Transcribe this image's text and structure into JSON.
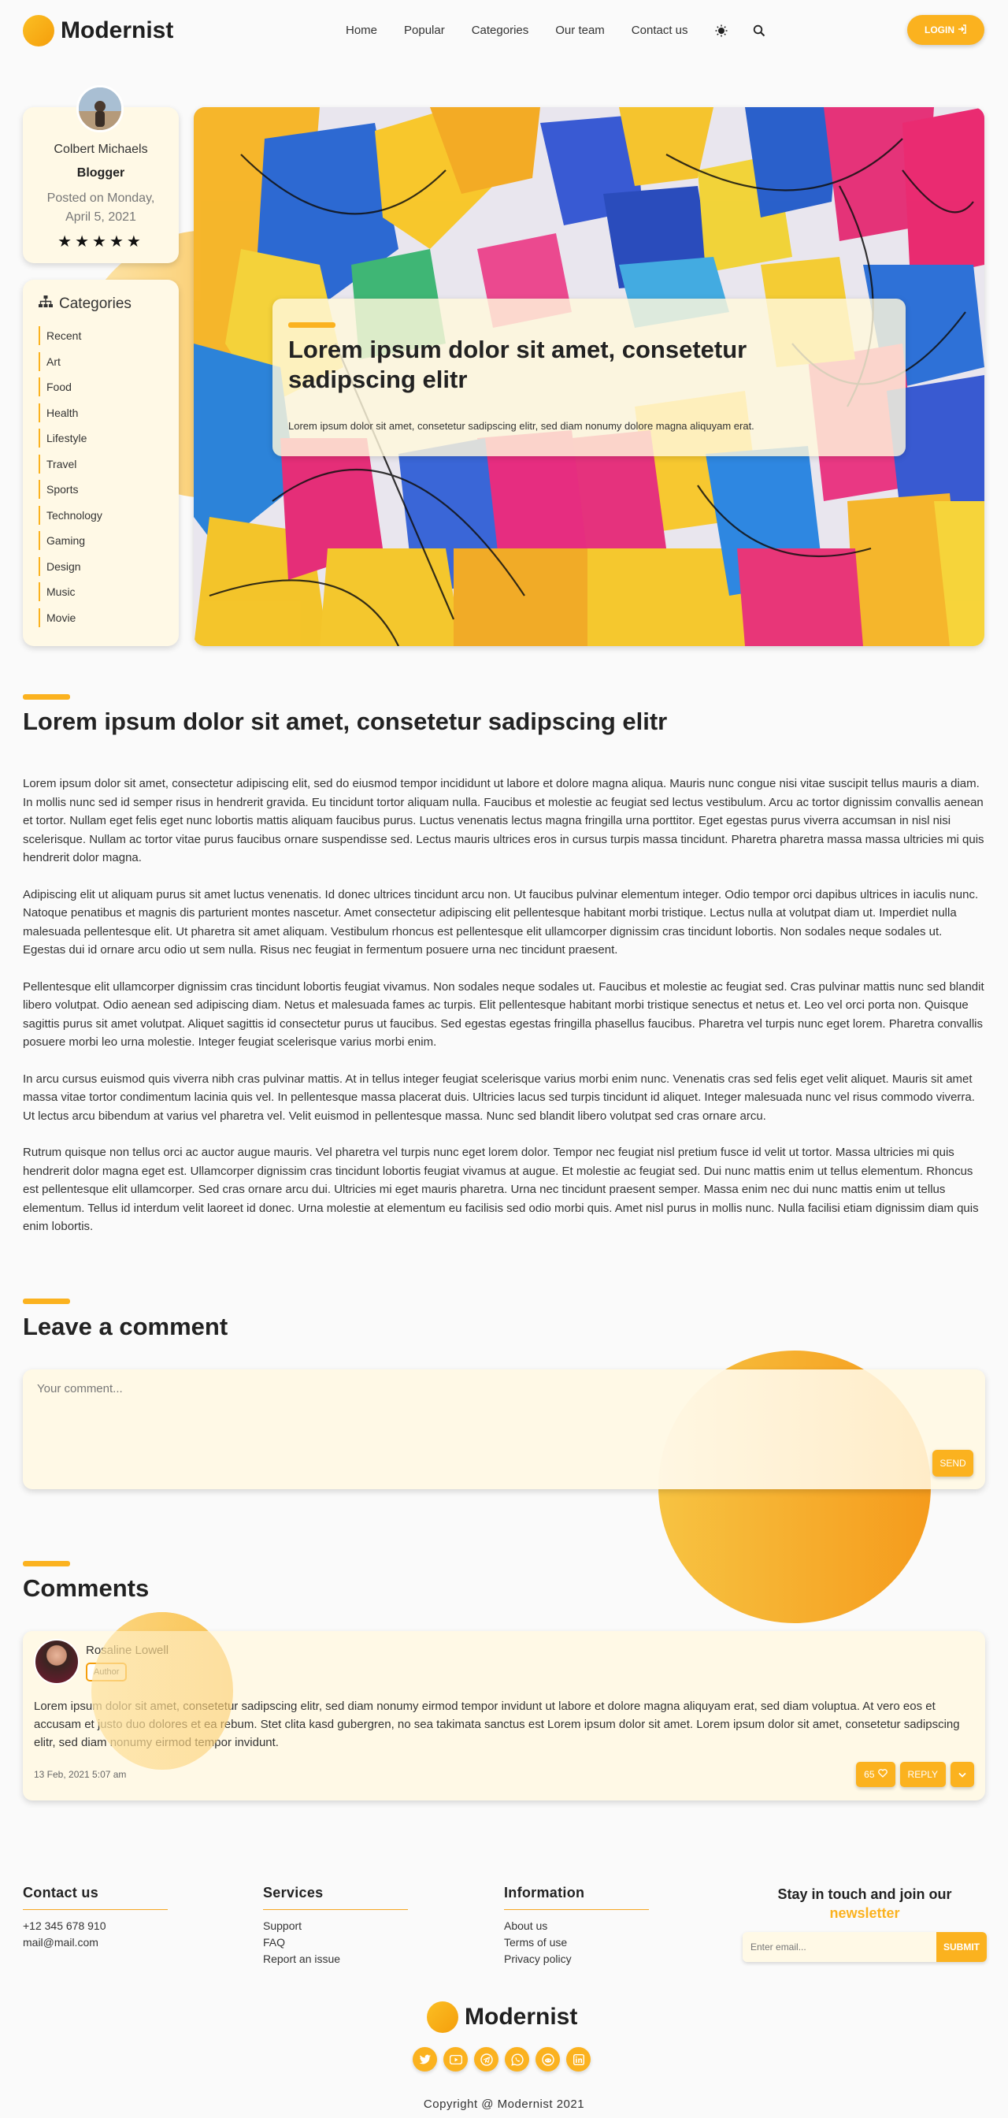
{
  "brand": {
    "name": "Modernist",
    "accent": "#fbb21f"
  },
  "nav": {
    "items": [
      "Home",
      "Popular",
      "Categories",
      "Our team",
      "Contact us"
    ],
    "login": "LOGIN"
  },
  "author": {
    "name": "Colbert Michaels",
    "role": "Blogger",
    "posted": "Posted on Monday, April 5, 2021",
    "stars": "★★★★★"
  },
  "categories": {
    "title": "Categories",
    "items": [
      "Recent",
      "Art",
      "Food",
      "Health",
      "Lifestyle",
      "Travel",
      "Sports",
      "Technology",
      "Gaming",
      "Design",
      "Music",
      "Movie"
    ]
  },
  "hero": {
    "title": "Lorem ipsum dolor sit amet, consetetur sadipscing elitr",
    "text": "Lorem ipsum dolor sit amet, consetetur sadipscing elitr, sed diam nonumy dolore magna aliquyam erat."
  },
  "article": {
    "title": "Lorem ipsum dolor sit amet, consetetur sadipscing elitr",
    "paragraphs": [
      "Lorem ipsum dolor sit amet, consectetur adipiscing elit, sed do eiusmod tempor incididunt ut labore et dolore magna aliqua. Mauris nunc congue nisi vitae suscipit tellus mauris a diam. In mollis nunc sed id semper risus in hendrerit gravida. Eu tincidunt tortor aliquam nulla. Faucibus et molestie ac feugiat sed lectus vestibulum. Arcu ac tortor dignissim convallis aenean et tortor. Nullam eget felis eget nunc lobortis mattis aliquam faucibus purus. Luctus venenatis lectus magna fringilla urna porttitor. Eget egestas purus viverra accumsan in nisl nisi scelerisque. Nullam ac tortor vitae purus faucibus ornare suspendisse sed. Lectus mauris ultrices eros in cursus turpis massa tincidunt. Pharetra pharetra massa massa ultricies mi quis hendrerit dolor magna.",
      "Adipiscing elit ut aliquam purus sit amet luctus venenatis. Id donec ultrices tincidunt arcu non. Ut faucibus pulvinar elementum integer. Odio tempor orci dapibus ultrices in iaculis nunc. Natoque penatibus et magnis dis parturient montes nascetur. Amet consectetur adipiscing elit pellentesque habitant morbi tristique. Lectus nulla at volutpat diam ut. Imperdiet nulla malesuada pellentesque elit. Ut pharetra sit amet aliquam. Vestibulum rhoncus est pellentesque elit ullamcorper dignissim cras tincidunt lobortis. Non sodales neque sodales ut. Egestas dui id ornare arcu odio ut sem nulla. Risus nec feugiat in fermentum posuere urna nec tincidunt praesent.",
      "Pellentesque elit ullamcorper dignissim cras tincidunt lobortis feugiat vivamus. Non sodales neque sodales ut. Faucibus et molestie ac feugiat sed. Cras pulvinar mattis nunc sed blandit libero volutpat. Odio aenean sed adipiscing diam. Netus et malesuada fames ac turpis. Elit pellentesque habitant morbi tristique senectus et netus et. Leo vel orci porta non. Quisque sagittis purus sit amet volutpat. Aliquet sagittis id consectetur purus ut faucibus. Sed egestas egestas fringilla phasellus faucibus. Pharetra vel turpis nunc eget lorem. Pharetra convallis posuere morbi leo urna molestie. Integer feugiat scelerisque varius morbi enim.",
      "In arcu cursus euismod quis viverra nibh cras pulvinar mattis. At in tellus integer feugiat scelerisque varius morbi enim nunc. Venenatis cras sed felis eget velit aliquet. Mauris sit amet massa vitae tortor condimentum lacinia quis vel. In pellentesque massa placerat duis. Ultricies lacus sed turpis tincidunt id aliquet. Integer malesuada nunc vel risus commodo viverra. Ut lectus arcu bibendum at varius vel pharetra vel. Velit euismod in pellentesque massa. Nunc sed blandit libero volutpat sed cras ornare arcu.",
      "Rutrum quisque non tellus orci ac auctor augue mauris. Vel pharetra vel turpis nunc eget lorem dolor. Tempor nec feugiat nisl pretium fusce id velit ut tortor. Massa ultricies mi quis hendrerit dolor magna eget est. Ullamcorper dignissim cras tincidunt lobortis feugiat vivamus at augue. Et molestie ac feugiat sed. Dui nunc mattis enim ut tellus elementum. Rhoncus est pellentesque elit ullamcorper. Sed cras ornare arcu dui. Ultricies mi eget mauris pharetra. Urna nec tincidunt praesent semper. Massa enim nec dui nunc mattis enim ut tellus elementum. Tellus id interdum velit laoreet id donec. Urna molestie at elementum eu facilisis sed odio morbi quis. Amet nisl purus in mollis nunc. Nulla facilisi etiam dignissim diam quis enim lobortis."
    ]
  },
  "leave_comment": {
    "title": "Leave a comment",
    "placeholder": "Your comment...",
    "send": "SEND"
  },
  "comments": {
    "title": "Comments",
    "items": [
      {
        "name": "Rosaline Lowell",
        "badge": "Author",
        "text": "Lorem ipsum dolor sit amet, consetetur sadipscing elitr, sed diam nonumy eirmod tempor invidunt ut labore et dolore magna aliquyam erat, sed diam voluptua. At vero eos et accusam et justo duo dolores et ea rebum. Stet clita kasd gubergren, no sea takimata sanctus est Lorem ipsum dolor sit amet. Lorem ipsum dolor sit amet, consetetur sadipscing elitr, sed diam nonumy eirmod tempor invidunt.",
        "date": "13 Feb, 2021 5:07 am",
        "likes": "65",
        "reply": "REPLY"
      }
    ]
  },
  "footer": {
    "contact": {
      "title": "Contact us",
      "items": [
        "+12 345 678 910",
        "mail@mail.com"
      ]
    },
    "services": {
      "title": "Services",
      "items": [
        "Support",
        "FAQ",
        "Report an issue"
      ]
    },
    "information": {
      "title": "Information",
      "items": [
        "About us",
        "Terms of use",
        "Privacy policy"
      ]
    },
    "newsletter": {
      "title": "Stay in touch and join our",
      "highlight": "newsletter",
      "placeholder": "Enter email...",
      "submit": "SUBMIT"
    },
    "brand": "Modernist",
    "social": [
      "twitter-icon",
      "youtube-icon",
      "telegram-icon",
      "whatsapp-icon",
      "reddit-icon",
      "linkedin-icon"
    ],
    "copyright": "Copyright @ Modernist 2021"
  }
}
